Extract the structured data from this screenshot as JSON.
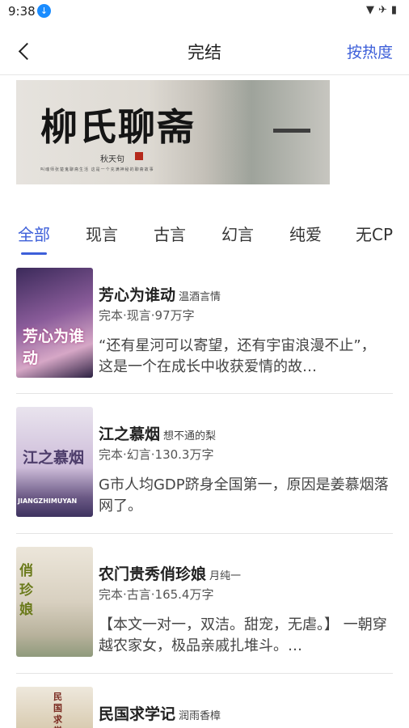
{
  "status_bar": {
    "time": "9:38",
    "download_icon": "download-icon",
    "icons": [
      "wifi-icon",
      "airplane-mode-icon",
      "battery-icon"
    ]
  },
  "header": {
    "title": "完结",
    "sort_label": "按热度",
    "back_icon": "chevron-left-icon"
  },
  "banner": {
    "title": "柳氏聊斋",
    "author": "秋天句",
    "subtitle": "叫魂师张楚鬼聊斋生活 这是一个充满神秘的聊斋故事"
  },
  "tabs": [
    "全部",
    "现言",
    "古言",
    "幻言",
    "纯爱",
    "无CP"
  ],
  "books": [
    {
      "title": "芳心为谁动",
      "author": "温酒言情",
      "meta": "完本·现言·97万字",
      "desc": "“还有星河可以寄望，还有宇宙浪漫不止”，这是一个在成长中收获爱情的故…",
      "cover_text": "芳心为谁动"
    },
    {
      "title": "江之慕烟",
      "author": "想不通的梨",
      "meta": "完本·幻言·130.3万字",
      "desc": "G市人均GDP跻身全国第一，原因是姜慕烟落网了。",
      "cover_text": "江之慕烟",
      "cover_sub": "JIANGZHIMUYAN"
    },
    {
      "title": "农门贵秀俏珍娘",
      "author": "月纯一",
      "meta": "完本·古言·165.4万字",
      "desc": "【本文一对一，双洁。甜宠，无虐。】 一朝穿越农家女，极品亲戚扎堆斗。…",
      "cover_text": "俏珍娘"
    },
    {
      "title": "民国求学记",
      "author": "润雨香樟",
      "meta": "",
      "desc": "",
      "cover_text": "民国求学"
    }
  ],
  "colors": {
    "accent": "#3d5fd9"
  }
}
